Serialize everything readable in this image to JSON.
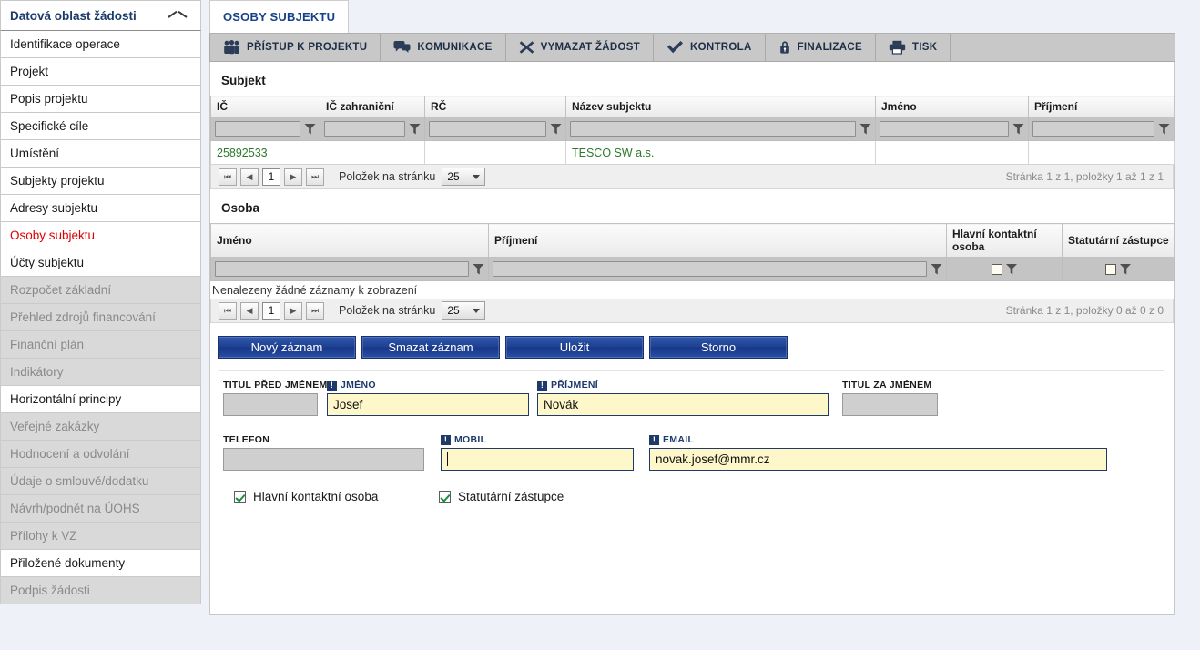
{
  "sidebar": {
    "header": "Datová oblast žádosti",
    "chevron_icon": "chevron-up-icon",
    "items": [
      {
        "label": "Identifikace operace",
        "state": "enabled"
      },
      {
        "label": "Projekt",
        "state": "enabled"
      },
      {
        "label": "Popis projektu",
        "state": "enabled"
      },
      {
        "label": "Specifické cíle",
        "state": "enabled"
      },
      {
        "label": "Umístění",
        "state": "enabled"
      },
      {
        "label": "Subjekty projektu",
        "state": "enabled"
      },
      {
        "label": "Adresy subjektu",
        "state": "enabled"
      },
      {
        "label": "Osoby subjektu",
        "state": "active"
      },
      {
        "label": "Účty subjektu",
        "state": "enabled"
      },
      {
        "label": "Rozpočet základní",
        "state": "disabled"
      },
      {
        "label": "Přehled zdrojů financování",
        "state": "disabled"
      },
      {
        "label": "Finanční plán",
        "state": "disabled"
      },
      {
        "label": "Indikátory",
        "state": "disabled"
      },
      {
        "label": "Horizontální principy",
        "state": "enabled"
      },
      {
        "label": "Veřejné zakázky",
        "state": "disabled"
      },
      {
        "label": "Hodnocení a odvolání",
        "state": "disabled"
      },
      {
        "label": "Údaje o smlouvě/dodatku",
        "state": "disabled"
      },
      {
        "label": "Návrh/podnět na ÚOHS",
        "state": "disabled"
      },
      {
        "label": "Přílohy k VZ",
        "state": "disabled"
      },
      {
        "label": "Přiložené dokumenty",
        "state": "enabled"
      },
      {
        "label": "Podpis žádosti",
        "state": "disabled"
      }
    ]
  },
  "page_tab": {
    "label": "OSOBY SUBJEKTU"
  },
  "toolbar": {
    "buttons": [
      {
        "label": "PŘÍSTUP K PROJEKTU",
        "icon": "people-icon"
      },
      {
        "label": "KOMUNIKACE",
        "icon": "speech-bubble-icon"
      },
      {
        "label": "VYMAZAT ŽÁDOST",
        "icon": "x-mark-icon"
      },
      {
        "label": "KONTROLA",
        "icon": "checkmark-icon"
      },
      {
        "label": "FINALIZACE",
        "icon": "lock-icon"
      },
      {
        "label": "TISK",
        "icon": "printer-icon"
      }
    ]
  },
  "subjekt": {
    "title": "Subjekt",
    "columns": [
      "IČ",
      "IČ zahraniční",
      "RČ",
      "Název subjektu",
      "Jméno",
      "Příjmení"
    ],
    "rows": [
      {
        "ic": "25892533",
        "ic_zahranicni": "",
        "rc": "",
        "nazev_subjektu": "TESCO SW a.s.",
        "jmeno": "",
        "prijmeni": ""
      }
    ],
    "pager": {
      "page_value": "1",
      "per_page_label": "Položek na stránku",
      "per_page_value": "25",
      "status_prefix": "Stránka",
      "status": "Stránka 1 z 1, položky 1 až 1 z 1",
      "status_parts": {
        "page_cur": "1",
        "page_total": "1",
        "from": "1",
        "to": "1",
        "total": "1"
      }
    }
  },
  "osoba": {
    "title": "Osoba",
    "columns": [
      "Jméno",
      "Příjmení",
      "Hlavní kontaktní osoba",
      "Statutární zástupce"
    ],
    "empty_message": "Nenalezeny žádné záznamy k zobrazení",
    "rows": [],
    "pager": {
      "page_value": "1",
      "per_page_label": "Položek na stránku",
      "per_page_value": "25",
      "status": "Stránka 1 z 1, položky 0 až 0 z 0",
      "status_parts": {
        "page_cur": "1",
        "page_total": "1",
        "from": "0",
        "to": "0",
        "total": "0"
      }
    }
  },
  "actions": {
    "new_record": "Nový záznam",
    "delete_record": "Smazat záznam",
    "save": "Uložit",
    "cancel": "Storno"
  },
  "form": {
    "titul_pred": {
      "label": "TITUL PŘED JMÉNEM",
      "value": "",
      "readonly": true,
      "required": false
    },
    "jmeno": {
      "label": "JMÉNO",
      "value": "Josef",
      "readonly": false,
      "required": true
    },
    "prijmeni": {
      "label": "PŘÍJMENÍ",
      "value": "Novák",
      "readonly": false,
      "required": true
    },
    "titul_za": {
      "label": "TITUL ZA JMÉNEM",
      "value": "",
      "readonly": true,
      "required": false
    },
    "telefon": {
      "label": "TELEFON",
      "value": "",
      "readonly": true,
      "required": false
    },
    "mobil": {
      "label": "MOBIL",
      "value": "",
      "readonly": false,
      "required": true,
      "focused": true
    },
    "email": {
      "label": "EMAIL",
      "value": "novak.josef@mmr.cz",
      "readonly": false,
      "required": true
    },
    "checkboxes": [
      {
        "label": "Hlavní kontaktní osoba",
        "checked": true
      },
      {
        "label": "Statutární zástupce",
        "checked": true
      }
    ]
  },
  "colors": {
    "accent_blue": "#1d3a6b",
    "active_red": "#e00000",
    "field_yellow": "#fdf7c9",
    "grid_value_green": "#2b7a2b",
    "button_blue": "#1e3f8f"
  }
}
